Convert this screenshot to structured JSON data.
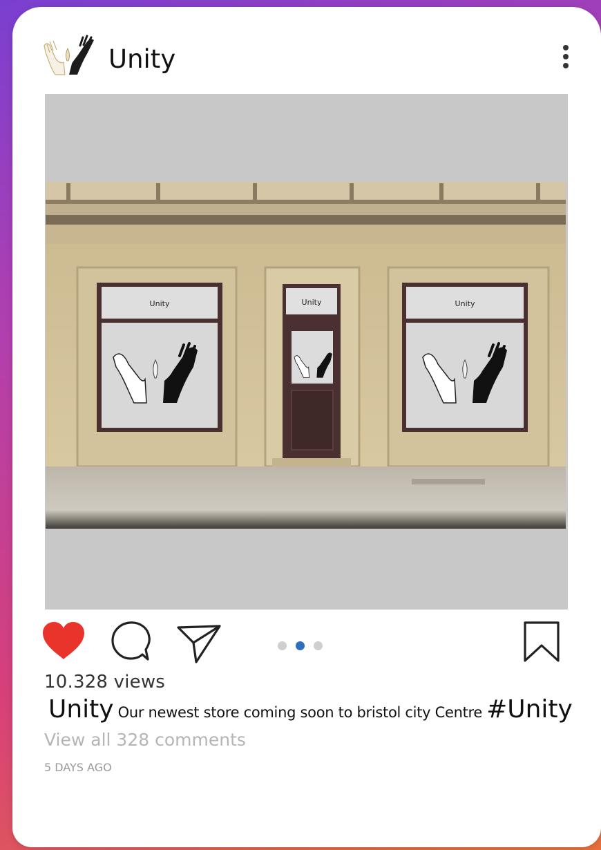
{
  "post": {
    "username": "Unity",
    "views": "10.328 views",
    "caption": {
      "user": "Unity",
      "text": "Our newest store coming soon to bristol city Centre",
      "hashtag": "#Unity"
    },
    "view_comments": "View all 328 comments",
    "time_ago": "5 DAYS AGO",
    "carousel": {
      "count": 3,
      "active_index": 1
    },
    "liked": true
  },
  "photo": {
    "window_left_sign": "Unity",
    "door_sign": "Unity",
    "window_right_sign": "Unity"
  },
  "icons": {
    "avatar": "hands-logo-icon",
    "more": "more-vertical-icon",
    "like": "heart-icon",
    "comment": "comment-bubble-icon",
    "share": "paper-plane-icon",
    "save": "bookmark-icon"
  },
  "colors": {
    "like": "#e8342a",
    "active_dot": "#2f6fbd",
    "inactive_dot": "#cfcfcf",
    "muted_text": "#b5b5b5"
  }
}
